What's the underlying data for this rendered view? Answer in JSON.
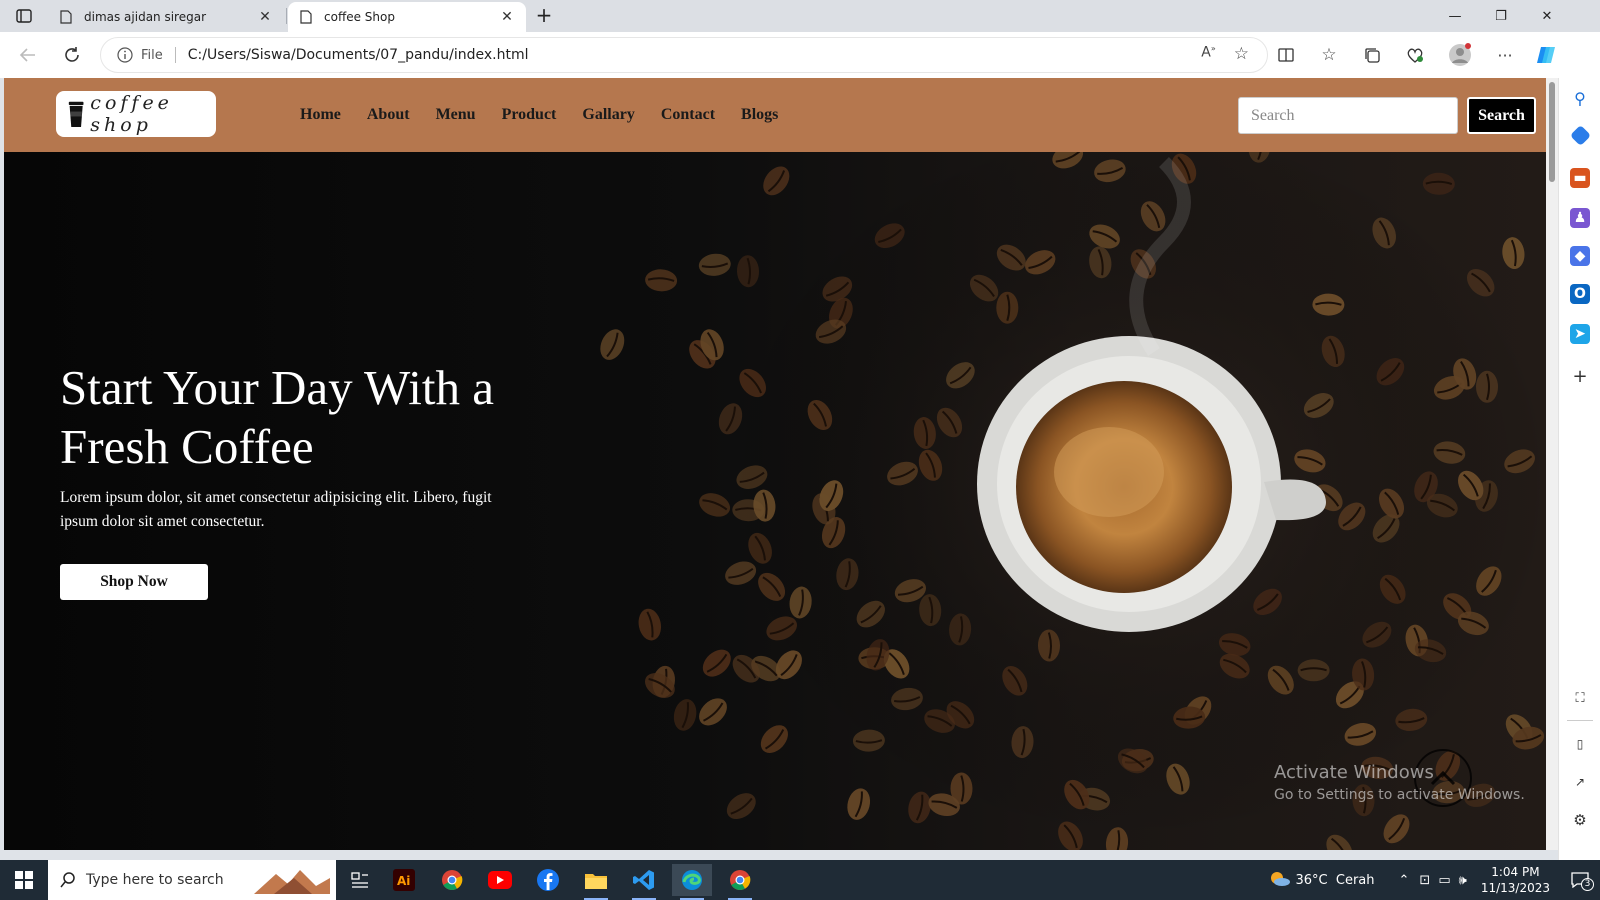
{
  "browser": {
    "tabs": [
      {
        "title": "dimas ajidan siregar",
        "active": false
      },
      {
        "title": "coffee Shop",
        "active": true
      }
    ],
    "address": {
      "scheme_label": "File",
      "url": "C:/Users/Siswa/Documents/07_pandu/index.html"
    }
  },
  "site": {
    "logo_text": "coffee shop",
    "nav": [
      "Home",
      "About",
      "Menu",
      "Product",
      "Gallary",
      "Contact",
      "Blogs"
    ],
    "search": {
      "placeholder": "Search",
      "button": "Search"
    },
    "hero": {
      "title": "Start Your Day With a Fresh Coffee",
      "text": "Lorem ipsum dolor, sit amet consectetur adipisicing elit. Libero, fugit ipsum dolor sit amet consectetur.",
      "button": "Shop Now"
    },
    "colors": {
      "nav_bg": "#b5774e",
      "hero_bg": "#0b0b0b"
    }
  },
  "watermark": {
    "line1": "Activate Windows",
    "line2": "Go to Settings to activate Windows."
  },
  "taskbar": {
    "search_placeholder": "Type here to search",
    "weather": "36°C  Cerah",
    "time": "1:04 PM",
    "date": "11/13/2023",
    "notifications": "3",
    "apps": [
      "task-view-icon",
      "illustrator-icon",
      "chrome-icon",
      "youtube-icon",
      "facebook-icon",
      "file-explorer-icon",
      "vscode-icon",
      "edge-icon",
      "chrome-icon"
    ]
  }
}
